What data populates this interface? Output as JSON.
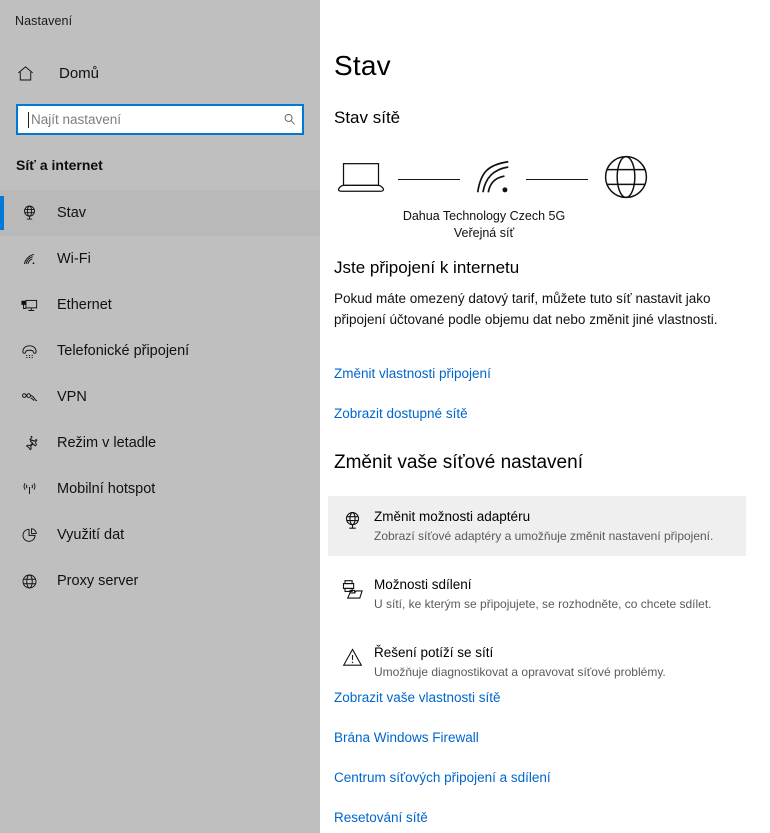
{
  "window": {
    "title": "Nastavení"
  },
  "sidebar": {
    "home": {
      "label": "Domů",
      "icon": "home-icon"
    },
    "search": {
      "placeholder": "Najít nastavení",
      "value": "",
      "icon": "search-icon"
    },
    "section_heading": "Síť a internet",
    "items": [
      {
        "label": "Stav",
        "icon": "network-status-icon",
        "selected": true
      },
      {
        "label": "Wi-Fi",
        "icon": "wifi-icon",
        "selected": false
      },
      {
        "label": "Ethernet",
        "icon": "ethernet-icon",
        "selected": false
      },
      {
        "label": "Telefonické připojení",
        "icon": "dialup-phone-icon",
        "selected": false
      },
      {
        "label": "VPN",
        "icon": "vpn-icon",
        "selected": false
      },
      {
        "label": "Režim v letadle",
        "icon": "airplane-icon",
        "selected": false
      },
      {
        "label": "Mobilní hotspot",
        "icon": "hotspot-icon",
        "selected": false
      },
      {
        "label": "Využití dat",
        "icon": "data-usage-pie-icon",
        "selected": false
      },
      {
        "label": "Proxy server",
        "icon": "globe-icon",
        "selected": false
      }
    ],
    "accent_color": "#0078d7",
    "background_color": "#bfbfbf"
  },
  "main": {
    "page_title": "Stav",
    "subhead": "Stav sítě",
    "diagram": {
      "device_icon": "laptop-icon",
      "signal_icon": "wifi-signal-icon",
      "internet_icon": "globe-icon",
      "network_name": "Dahua Technology Czech 5G",
      "network_type": "Veřejná síť"
    },
    "status_title": "Jste připojení k internetu",
    "status_desc": "Pokud máte omezený datový tarif, můžete tuto síť nastavit jako připojení účtované podle objemu dat nebo změnit jiné vlastnosti.",
    "links_top": [
      "Změnit vlastnosti připojení",
      "Zobrazit dostupné sítě"
    ],
    "section2_title": "Změnit vaše síťové nastavení",
    "options": [
      {
        "title": "Změnit možnosti adaptéru",
        "sub": "Zobrazí síťové adaptéry a umožňuje změnit nastavení připojení.",
        "icon": "network-adapter-icon",
        "highlighted": true
      },
      {
        "title": "Možnosti sdílení",
        "sub": "U sítí, ke kterým se připojujete, se rozhodněte, co chcete sdílet.",
        "icon": "sharing-printer-folder-icon",
        "highlighted": false
      },
      {
        "title": "Řešení potíží se sítí",
        "sub": "Umožňuje diagnostikovat a opravovat síťové problémy.",
        "icon": "troubleshoot-warning-icon",
        "highlighted": false
      }
    ],
    "links_bottom": [
      "Zobrazit vaše vlastnosti sítě",
      "Brána Windows Firewall",
      "Centrum síťových připojení a sdílení",
      "Resetování sítě"
    ],
    "link_color": "#0066cc",
    "highlight_color": "#efefef"
  }
}
